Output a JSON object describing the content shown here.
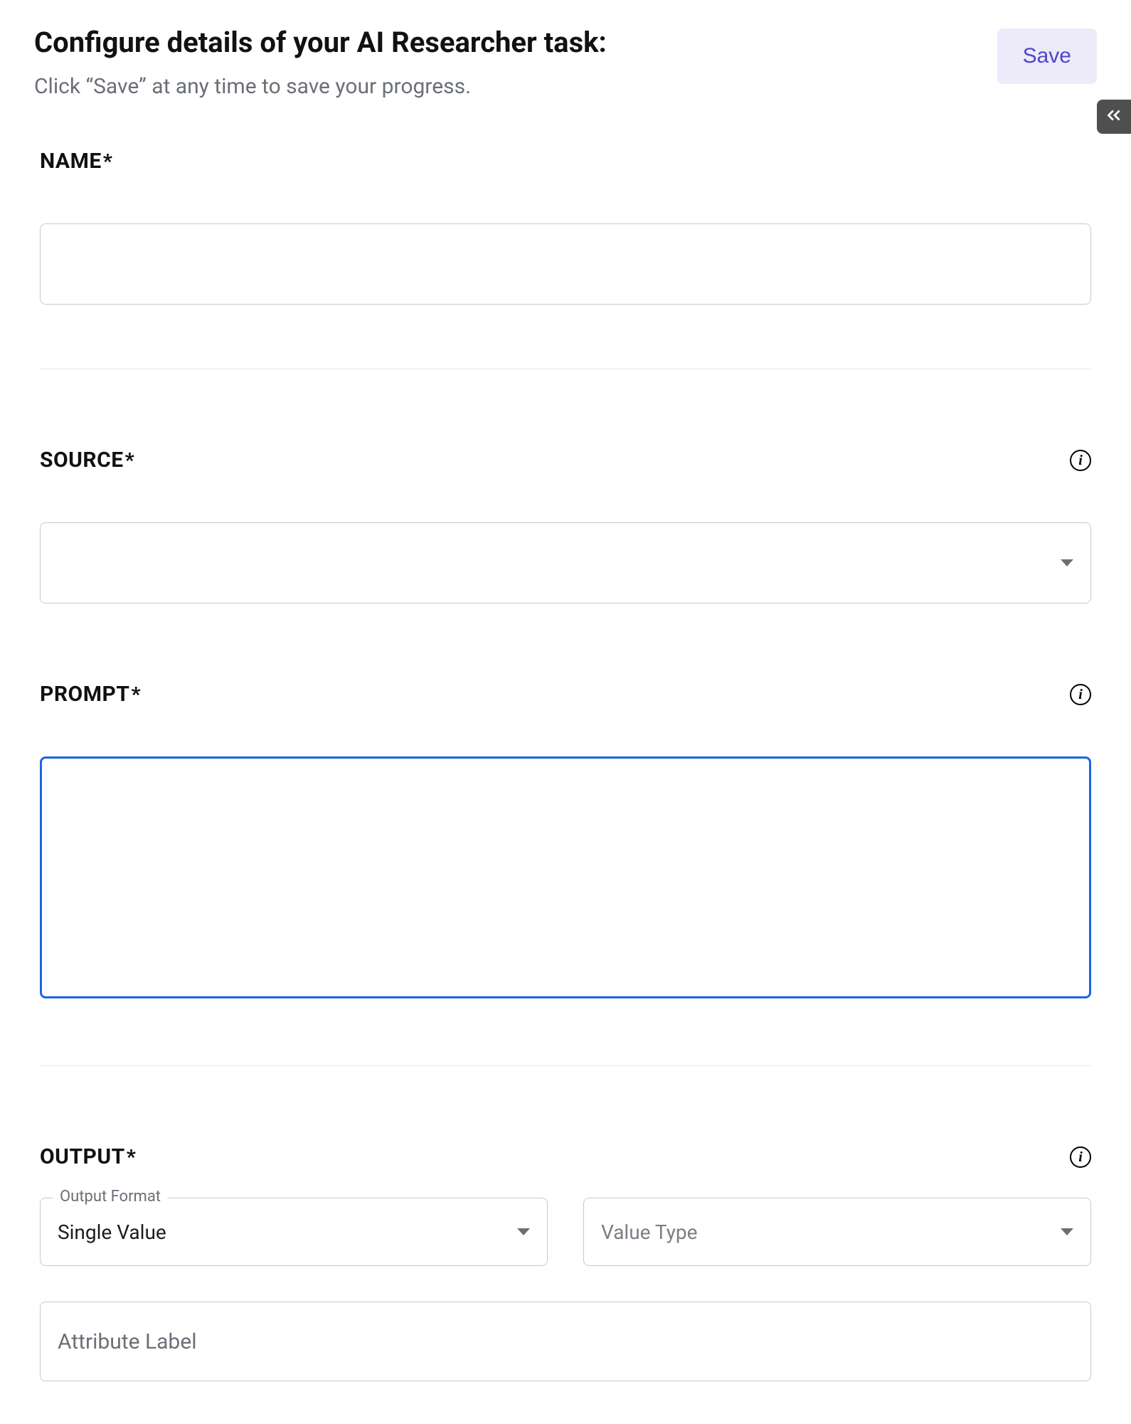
{
  "header": {
    "title": "Configure details of your AI Researcher task:",
    "subtitle": "Click “Save” at any time to save your progress.",
    "save_label": "Save"
  },
  "form": {
    "name": {
      "label": "NAME",
      "required_marker": "*",
      "value": ""
    },
    "source": {
      "label": "SOURCE",
      "required_marker": "*",
      "value": ""
    },
    "prompt": {
      "label": "PROMPT",
      "required_marker": "*",
      "value": ""
    },
    "output": {
      "label": "OUTPUT",
      "required_marker": "*",
      "format": {
        "floating_label": "Output Format",
        "value": "Single Value"
      },
      "value_type": {
        "placeholder": "Value Type",
        "value": ""
      },
      "attribute_label": {
        "placeholder": "Attribute Label",
        "value": ""
      }
    }
  },
  "info_glyph": "i"
}
